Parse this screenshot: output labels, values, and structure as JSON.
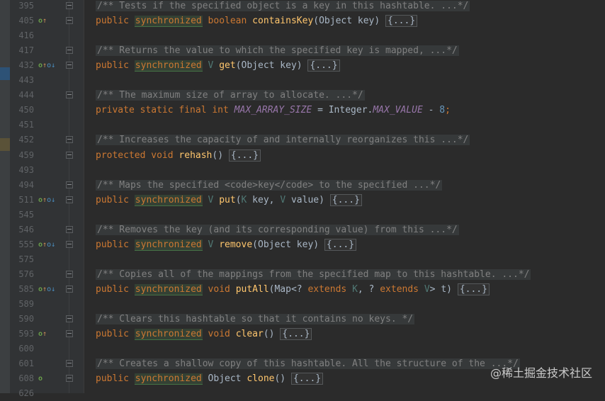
{
  "lines": [
    {
      "num": "395",
      "comment": "/** Tests if the specified object is a key in this hashtable. ...*/"
    },
    {
      "num": "405",
      "icons": "override-up",
      "code": "containsKey",
      "kw": "public",
      "sync": "synchronized",
      "type": "boolean",
      "fn": "containsKey",
      "args": "(Object key)",
      "fold": "{...}"
    },
    {
      "num": "416"
    },
    {
      "num": "417",
      "comment": "/** Returns the value to which the specified key is mapped, ...*/"
    },
    {
      "num": "432",
      "kw": "public",
      "sync": "synchronized",
      "type": "V",
      "fn": "get",
      "args": "(Object key)",
      "fold": "{...}"
    },
    {
      "num": "443"
    },
    {
      "num": "444",
      "comment": "/** The maximum size of array to allocate. ...*/"
    },
    {
      "num": "450"
    },
    {
      "num": "451"
    },
    {
      "num": "452",
      "comment": "/** Increases the capacity of and internally reorganizes this ...*/"
    },
    {
      "num": "459",
      "kw": "protected",
      "type": "void",
      "fn": "rehash",
      "args": "()",
      "fold": "{...}"
    },
    {
      "num": "493"
    },
    {
      "num": "494",
      "comment": "/** Maps the specified <code>key</code> to the specified ...*/"
    },
    {
      "num": "511",
      "kw": "public",
      "sync": "synchronized",
      "type": "V",
      "fn": "put"
    },
    {
      "num": "545"
    },
    {
      "num": "546",
      "comment": "/** Removes the key (and its corresponding value) from this ...*/"
    },
    {
      "num": "555",
      "kw": "public",
      "sync": "synchronized",
      "type": "V",
      "fn": "remove",
      "args": "(Object key)",
      "fold": "{...}"
    },
    {
      "num": "575"
    },
    {
      "num": "576",
      "comment": "/** Copies all of the mappings from the specified map to this hashtable. ...*/"
    },
    {
      "num": "585",
      "kw": "public",
      "sync": "synchronized",
      "type": "void",
      "fn": "putAll"
    },
    {
      "num": "589"
    },
    {
      "num": "590",
      "comment": "/** Clears this hashtable so that it contains no keys. */"
    },
    {
      "num": "593",
      "kw": "public",
      "sync": "synchronized",
      "type": "void",
      "fn": "clear",
      "args": "()",
      "fold": "{...}"
    },
    {
      "num": "600"
    },
    {
      "num": "601",
      "comment": "/** Creates a shallow copy of this hashtable. All the structure of the ...*/"
    },
    {
      "num": "608",
      "kw": "public",
      "sync": "synchronized",
      "type": "Object",
      "fn": "clone",
      "args": "()",
      "fold": "{...}"
    },
    {
      "num": "626"
    }
  ],
  "line450": {
    "kw": "private static final int",
    "field": "MAX_ARRAY_SIZE",
    "eq": " = Integer.",
    "field2": "MAX_VALUE",
    "rest": " - ",
    "num": "8",
    "end": ";"
  },
  "line511": {
    "open": "(",
    "t1": "K",
    "a1": " key, ",
    "t2": "V",
    "a2": " value)",
    "fold": "{...}"
  },
  "line585": {
    "open": "(Map<? ",
    "ext1": "extends",
    "t1": " K",
    "mid": ", ? ",
    "ext2": "extends",
    "t2": " V",
    "close": "> t)",
    "fold": "{...}"
  },
  "watermark": "@稀土掘金技术社区",
  "colors": {
    "background": "#2b2b2b",
    "gutter": "#313335",
    "keyword": "#cc7832",
    "method": "#ffc66d",
    "comment": "#808080",
    "field": "#9876aa"
  }
}
